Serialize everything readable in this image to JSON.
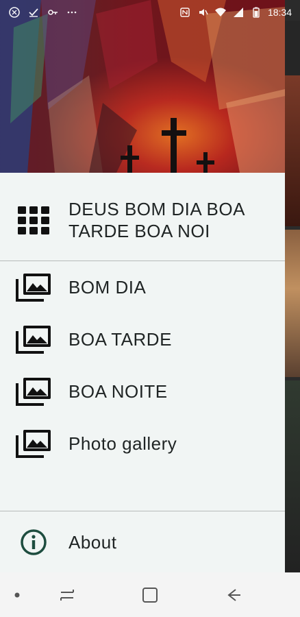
{
  "status_bar": {
    "time": "18:34",
    "left_icons": [
      "app-icon",
      "check-icon",
      "key-icon",
      "more-icon"
    ],
    "right_icons": [
      "nfc-icon",
      "mute-icon",
      "wifi-icon",
      "signal-icon",
      "battery-icon"
    ]
  },
  "drawer": {
    "header_image": "crosses-painting",
    "main_item": {
      "label": "DEUS BOM DIA BOA TARDE BOA NOI",
      "icon": "grid-icon"
    },
    "items": [
      {
        "label": "BOM DIA",
        "icon": "photo-library-icon"
      },
      {
        "label": "BOA TARDE",
        "icon": "photo-library-icon"
      },
      {
        "label": "BOA NOITE",
        "icon": "photo-library-icon"
      },
      {
        "label": "Photo gallery",
        "icon": "photo-library-icon"
      }
    ],
    "about": {
      "label": "About",
      "icon": "info-icon"
    }
  },
  "nav_bar": {
    "buttons": [
      "dot-button",
      "recents-button",
      "home-button",
      "back-button"
    ]
  },
  "colors": {
    "drawer_bg": "#f1f5f4",
    "text": "#1f2424",
    "divider": "#b6bab9",
    "info_icon": "#1e4d3f"
  }
}
